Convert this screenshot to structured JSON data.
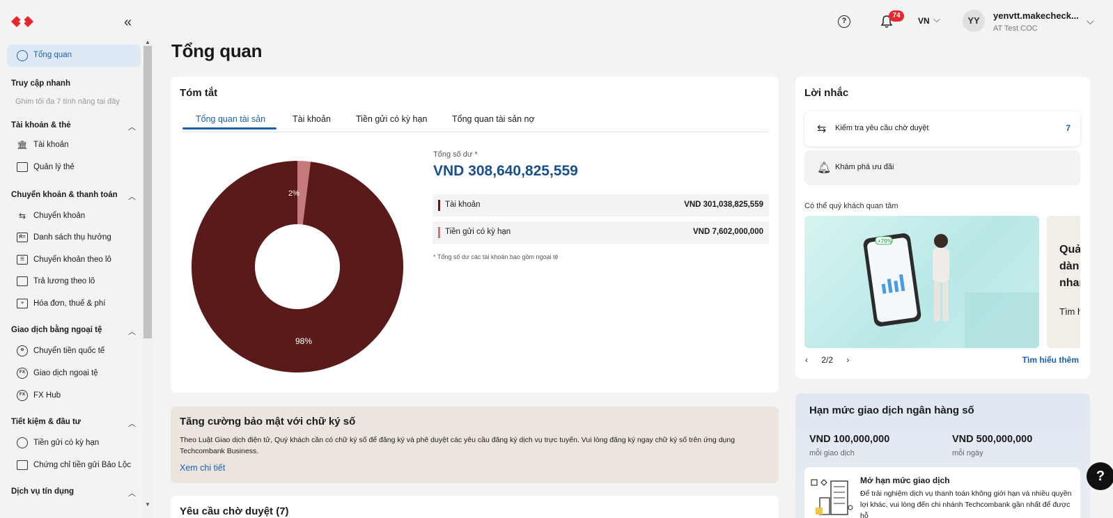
{
  "topbar": {
    "notif_count": "74",
    "language": "VN",
    "avatar_initials": "YY",
    "username": "yenvtt.makecheck...",
    "company": "AT Test COC"
  },
  "sidebar": {
    "active": "Tổng quan",
    "quick_access": {
      "title": "Truy cập nhanh",
      "hint": "Ghim tối đa 7 tính năng tại đây"
    },
    "sections": [
      {
        "title": "Tài khoản & thẻ",
        "items": [
          "Tài khoản",
          "Quản lý thẻ"
        ]
      },
      {
        "title": "Chuyển khoản & thanh toán",
        "items": [
          "Chuyển khoản",
          "Danh sách thụ hưởng",
          "Chuyển khoản theo lô",
          "Trả lương theo lô",
          "Hóa đơn, thuế & phí"
        ]
      },
      {
        "title": "Giao dịch bằng ngoại tệ",
        "items": [
          "Chuyển tiền quốc tế",
          "Giao dịch ngoại tệ",
          "FX Hub"
        ]
      },
      {
        "title": "Tiết kiệm & đầu tư",
        "items": [
          "Tiền gửi có kỳ hạn",
          "Chứng chỉ tiền gửi Bảo Lộc"
        ]
      },
      {
        "title": "Dịch vụ tín dụng",
        "items": []
      }
    ]
  },
  "main": {
    "title": "Tổng quan",
    "summary": {
      "title": "Tóm tắt",
      "tabs": [
        "Tổng quan tài sản",
        "Tài khoản",
        "Tiền gửi có kỳ hạn",
        "Tổng quan tài sản nợ"
      ],
      "total_label": "Tổng số dư *",
      "total_value": "VND 308,640,825,559",
      "rows": [
        {
          "name": "Tài khoản",
          "value": "VND 301,038,825,559",
          "color": "#5a1a1a"
        },
        {
          "name": "Tiền gửi có kỳ hạn",
          "value": "VND 7,602,000,000",
          "color": "#c77a7a"
        }
      ],
      "footnote": "* Tổng số dư các tài khoản bao gồm ngoại tệ",
      "chart_labels": [
        "98%",
        "2%"
      ]
    },
    "security": {
      "title": "Tăng cường bảo mật với chữ ký số",
      "text": "Theo Luật Giao dịch điện tử, Quý khách cần có chữ ký số để đăng ký và phê duyệt các yêu cầu đăng ký dịch vụ trực tuyến. Vui lòng đăng ký ngay chữ ký số trên ứng dụng Techcombank Business.",
      "link": "Xem chi tiết"
    },
    "pending": {
      "title": "Yêu cầu chờ duyệt (7)"
    }
  },
  "reminder": {
    "title": "Lời nhắc",
    "items": [
      {
        "label": "Kiểm tra yêu cầu chờ duyệt",
        "count": "7"
      },
      {
        "label": "Khám phá ưu đãi"
      }
    ],
    "interest_title": "Có thể quý khách quan tâm",
    "promo_badge": "+70%",
    "promo2_lines": [
      "Quả",
      "dàn",
      "nhan",
      "Tìm h"
    ],
    "pager": {
      "prev": "‹",
      "page": "2/2",
      "next": "›"
    },
    "learn_more": "Tìm hiểu thêm"
  },
  "limit": {
    "title": "Hạn mức giao dịch ngân hàng số",
    "per_tx_value": "VND 100,000,000",
    "per_tx_label": "mỗi giao dịch",
    "per_day_value": "VND 500,000,000",
    "per_day_label": "mỗi ngày",
    "open_title": "Mở hạn mức giao dịch",
    "open_text": "Để trải nghiệm dịch vụ thanh toán không giới hạn và nhiều quyền lợi khác, vui lòng đến chi nhánh Techcombank gần nhất để được hỗ"
  },
  "chart_data": {
    "type": "pie",
    "categories": [
      "Tài khoản",
      "Tiền gửi có kỳ hạn"
    ],
    "values": [
      98,
      2
    ],
    "colors": [
      "#5a1a1a",
      "#c77a7a"
    ]
  },
  "help_fab": "?"
}
